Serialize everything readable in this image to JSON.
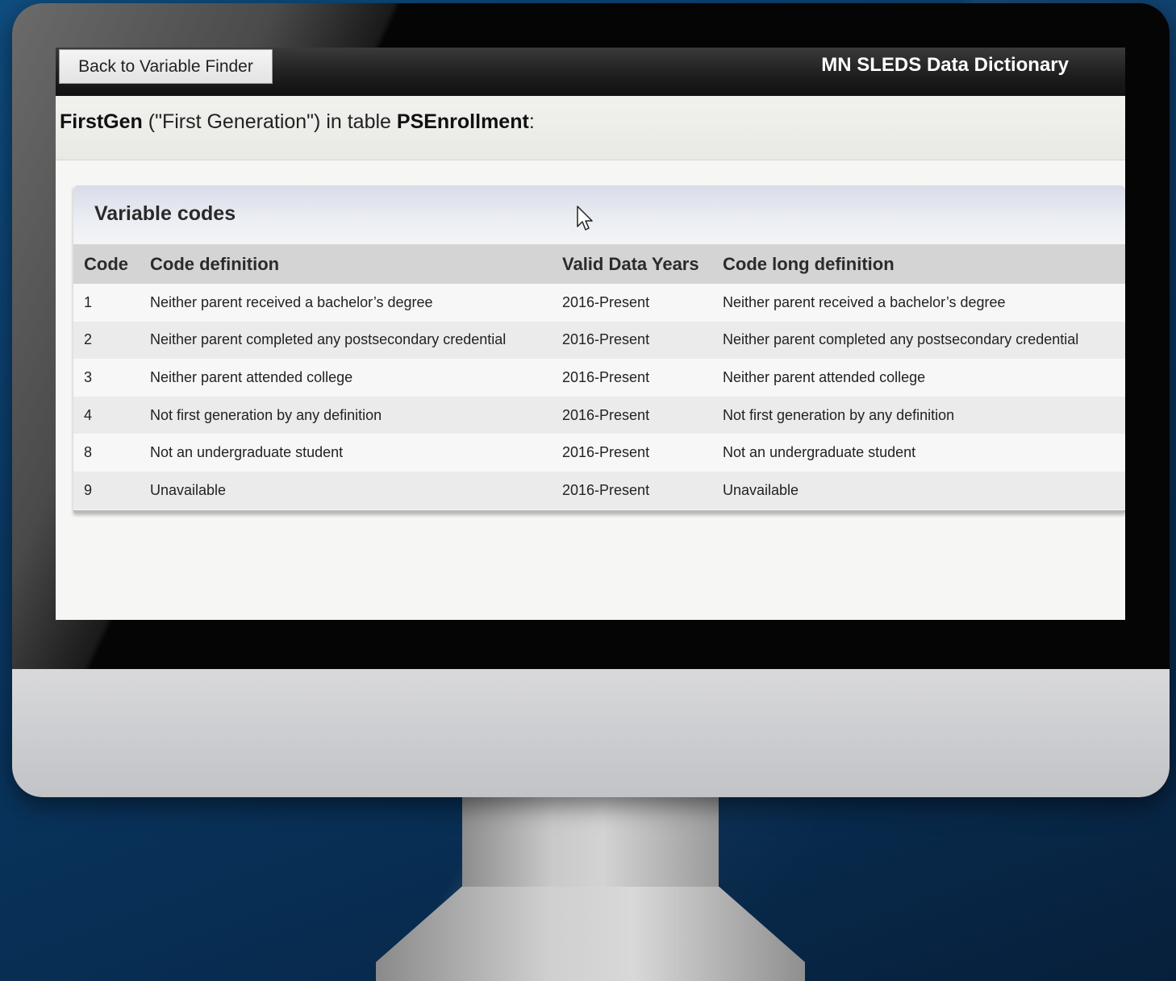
{
  "toolbar": {
    "back_label": "Back to Variable Finder",
    "app_title": "MN SLEDS Data Dictionary"
  },
  "subtitle": {
    "variable": "FirstGen",
    "description": " (\"First Generation\") in table ",
    "table": "PSEnrollment",
    "suffix": ":"
  },
  "panel": {
    "title": "Variable codes",
    "columns": [
      "Code",
      "Code definition",
      "Valid Data Years",
      "Code long definition"
    ],
    "rows": [
      {
        "code": "1",
        "definition": "Neither parent received a bachelor’s degree",
        "years": "2016-Present",
        "long": "Neither parent received a bachelor’s degree"
      },
      {
        "code": "2",
        "definition": "Neither parent completed any postsecondary credential",
        "years": "2016-Present",
        "long": "Neither parent completed any postsecondary credential"
      },
      {
        "code": "3",
        "definition": "Neither parent attended college",
        "years": "2016-Present",
        "long": "Neither parent attended college"
      },
      {
        "code": "4",
        "definition": "Not first generation by any definition",
        "years": "2016-Present",
        "long": "Not first generation by any definition"
      },
      {
        "code": "8",
        "definition": "Not an undergraduate student",
        "years": "2016-Present",
        "long": "Not an undergraduate student"
      },
      {
        "code": "9",
        "definition": "Unavailable",
        "years": "2016-Present",
        "long": "Unavailable"
      }
    ]
  },
  "icons": {
    "cursor": "mouse-pointer-icon"
  }
}
